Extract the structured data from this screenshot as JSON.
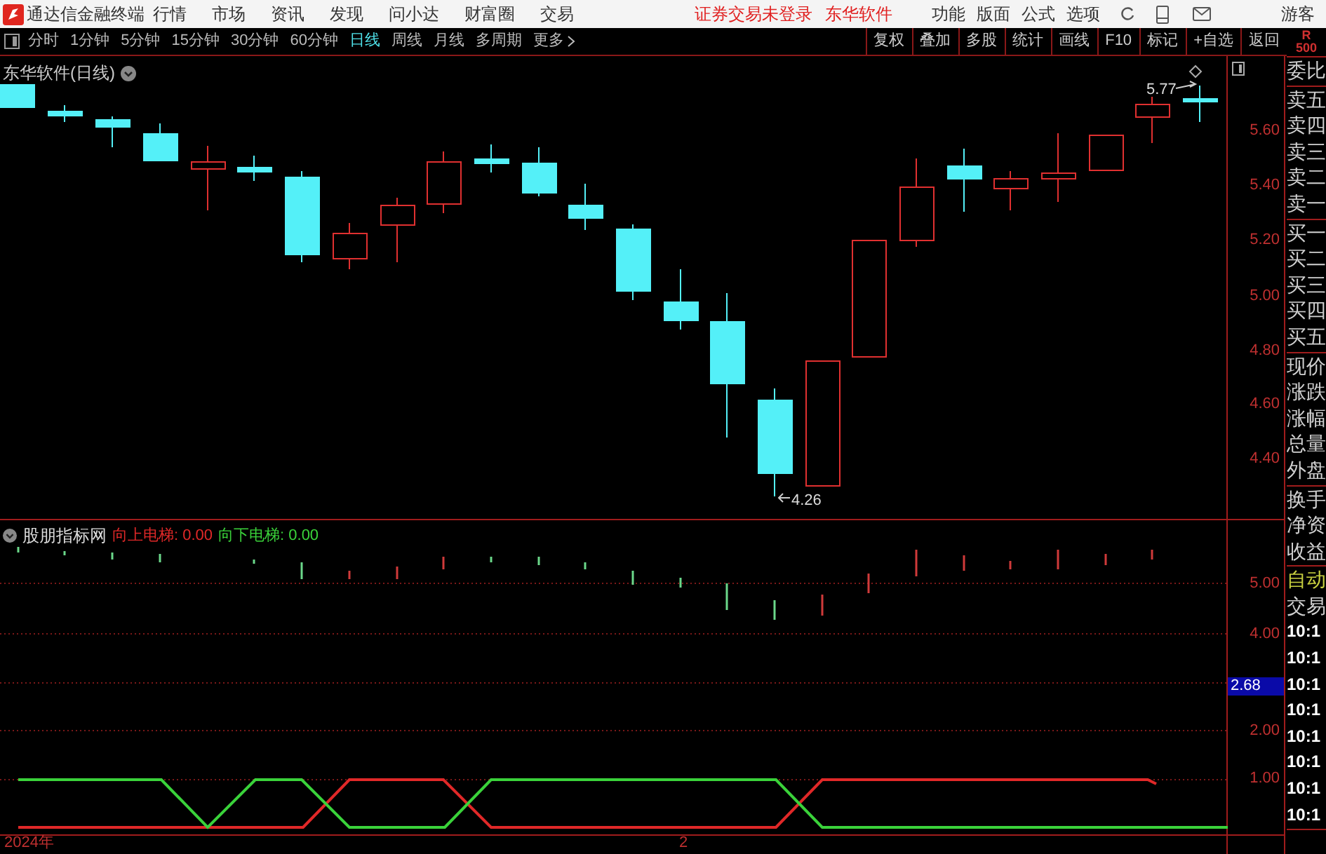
{
  "app_bar": {
    "title": "通达信金融终端",
    "menus": [
      "行情",
      "市场",
      "资讯",
      "发现",
      "问小达",
      "财富圈",
      "交易"
    ],
    "login_status": "证券交易未登录",
    "broker": "东华软件",
    "tools": [
      "功能",
      "版面",
      "公式",
      "选项"
    ],
    "user": "游客"
  },
  "toolbar": {
    "periods": [
      {
        "label": "分时",
        "selected": false
      },
      {
        "label": "1分钟",
        "selected": false
      },
      {
        "label": "5分钟",
        "selected": false
      },
      {
        "label": "15分钟",
        "selected": false
      },
      {
        "label": "30分钟",
        "selected": false
      },
      {
        "label": "60分钟",
        "selected": false
      },
      {
        "label": "日线",
        "selected": true
      },
      {
        "label": "周线",
        "selected": false
      },
      {
        "label": "月线",
        "selected": false
      },
      {
        "label": "多周期",
        "selected": false
      },
      {
        "label": "更多",
        "selected": false
      }
    ],
    "actions": [
      "复权",
      "叠加",
      "多股",
      "统计",
      "画线",
      "F10",
      "标记",
      "+自选",
      "返回"
    ]
  },
  "chart": {
    "title": "东华软件(日线)",
    "high_label": "5.77",
    "low_label": "4.26",
    "price_axis": [
      "5.60",
      "5.40",
      "5.20",
      "5.00",
      "4.80",
      "4.60",
      "4.40"
    ]
  },
  "indicator": {
    "name": "股朋指标网",
    "series": [
      {
        "label": "向上电梯: 0.00",
        "color": "#e02828"
      },
      {
        "label": "向下电梯: 0.00",
        "color": "#3ad23a"
      }
    ],
    "axis": [
      "5.00",
      "4.00",
      "2.00",
      "1.00"
    ],
    "cursor_value": "2.68"
  },
  "date_axis": [
    "2024年",
    "2"
  ],
  "side_panel": {
    "corner": [
      "R",
      "500"
    ],
    "sections": [
      {
        "rows": [
          {
            "text": "委比",
            "kind": "label"
          }
        ]
      },
      {
        "rows": [
          {
            "text": "卖五",
            "kind": "label"
          },
          {
            "text": "卖四",
            "kind": "label"
          },
          {
            "text": "卖三",
            "kind": "label"
          },
          {
            "text": "卖二",
            "kind": "label"
          },
          {
            "text": "卖一",
            "kind": "label"
          }
        ]
      },
      {
        "rows": [
          {
            "text": "买一",
            "kind": "label"
          },
          {
            "text": "买二",
            "kind": "label"
          },
          {
            "text": "买三",
            "kind": "label"
          },
          {
            "text": "买四",
            "kind": "label"
          },
          {
            "text": "买五",
            "kind": "label"
          }
        ]
      },
      {
        "rows": [
          {
            "text": "现价",
            "kind": "label"
          },
          {
            "text": "涨跌",
            "kind": "label"
          },
          {
            "text": "涨幅",
            "kind": "label"
          },
          {
            "text": "总量",
            "kind": "label"
          },
          {
            "text": "外盘",
            "kind": "label"
          }
        ]
      },
      {
        "rows": [
          {
            "text": "换手",
            "kind": "label"
          },
          {
            "text": "净资",
            "kind": "label"
          },
          {
            "text": "收益",
            "kind": "label"
          }
        ]
      },
      {
        "rows": [
          {
            "text": "自动",
            "kind": "heading"
          },
          {
            "text": "交易",
            "kind": "label"
          },
          {
            "text": "10:1",
            "kind": "time"
          },
          {
            "text": "10:1",
            "kind": "time"
          },
          {
            "text": "10:1",
            "kind": "time"
          },
          {
            "text": "10:1",
            "kind": "time"
          },
          {
            "text": "10:1",
            "kind": "time"
          },
          {
            "text": "10:1",
            "kind": "time"
          },
          {
            "text": "10:1",
            "kind": "time"
          },
          {
            "text": "10:1",
            "kind": "time"
          }
        ]
      }
    ]
  }
}
